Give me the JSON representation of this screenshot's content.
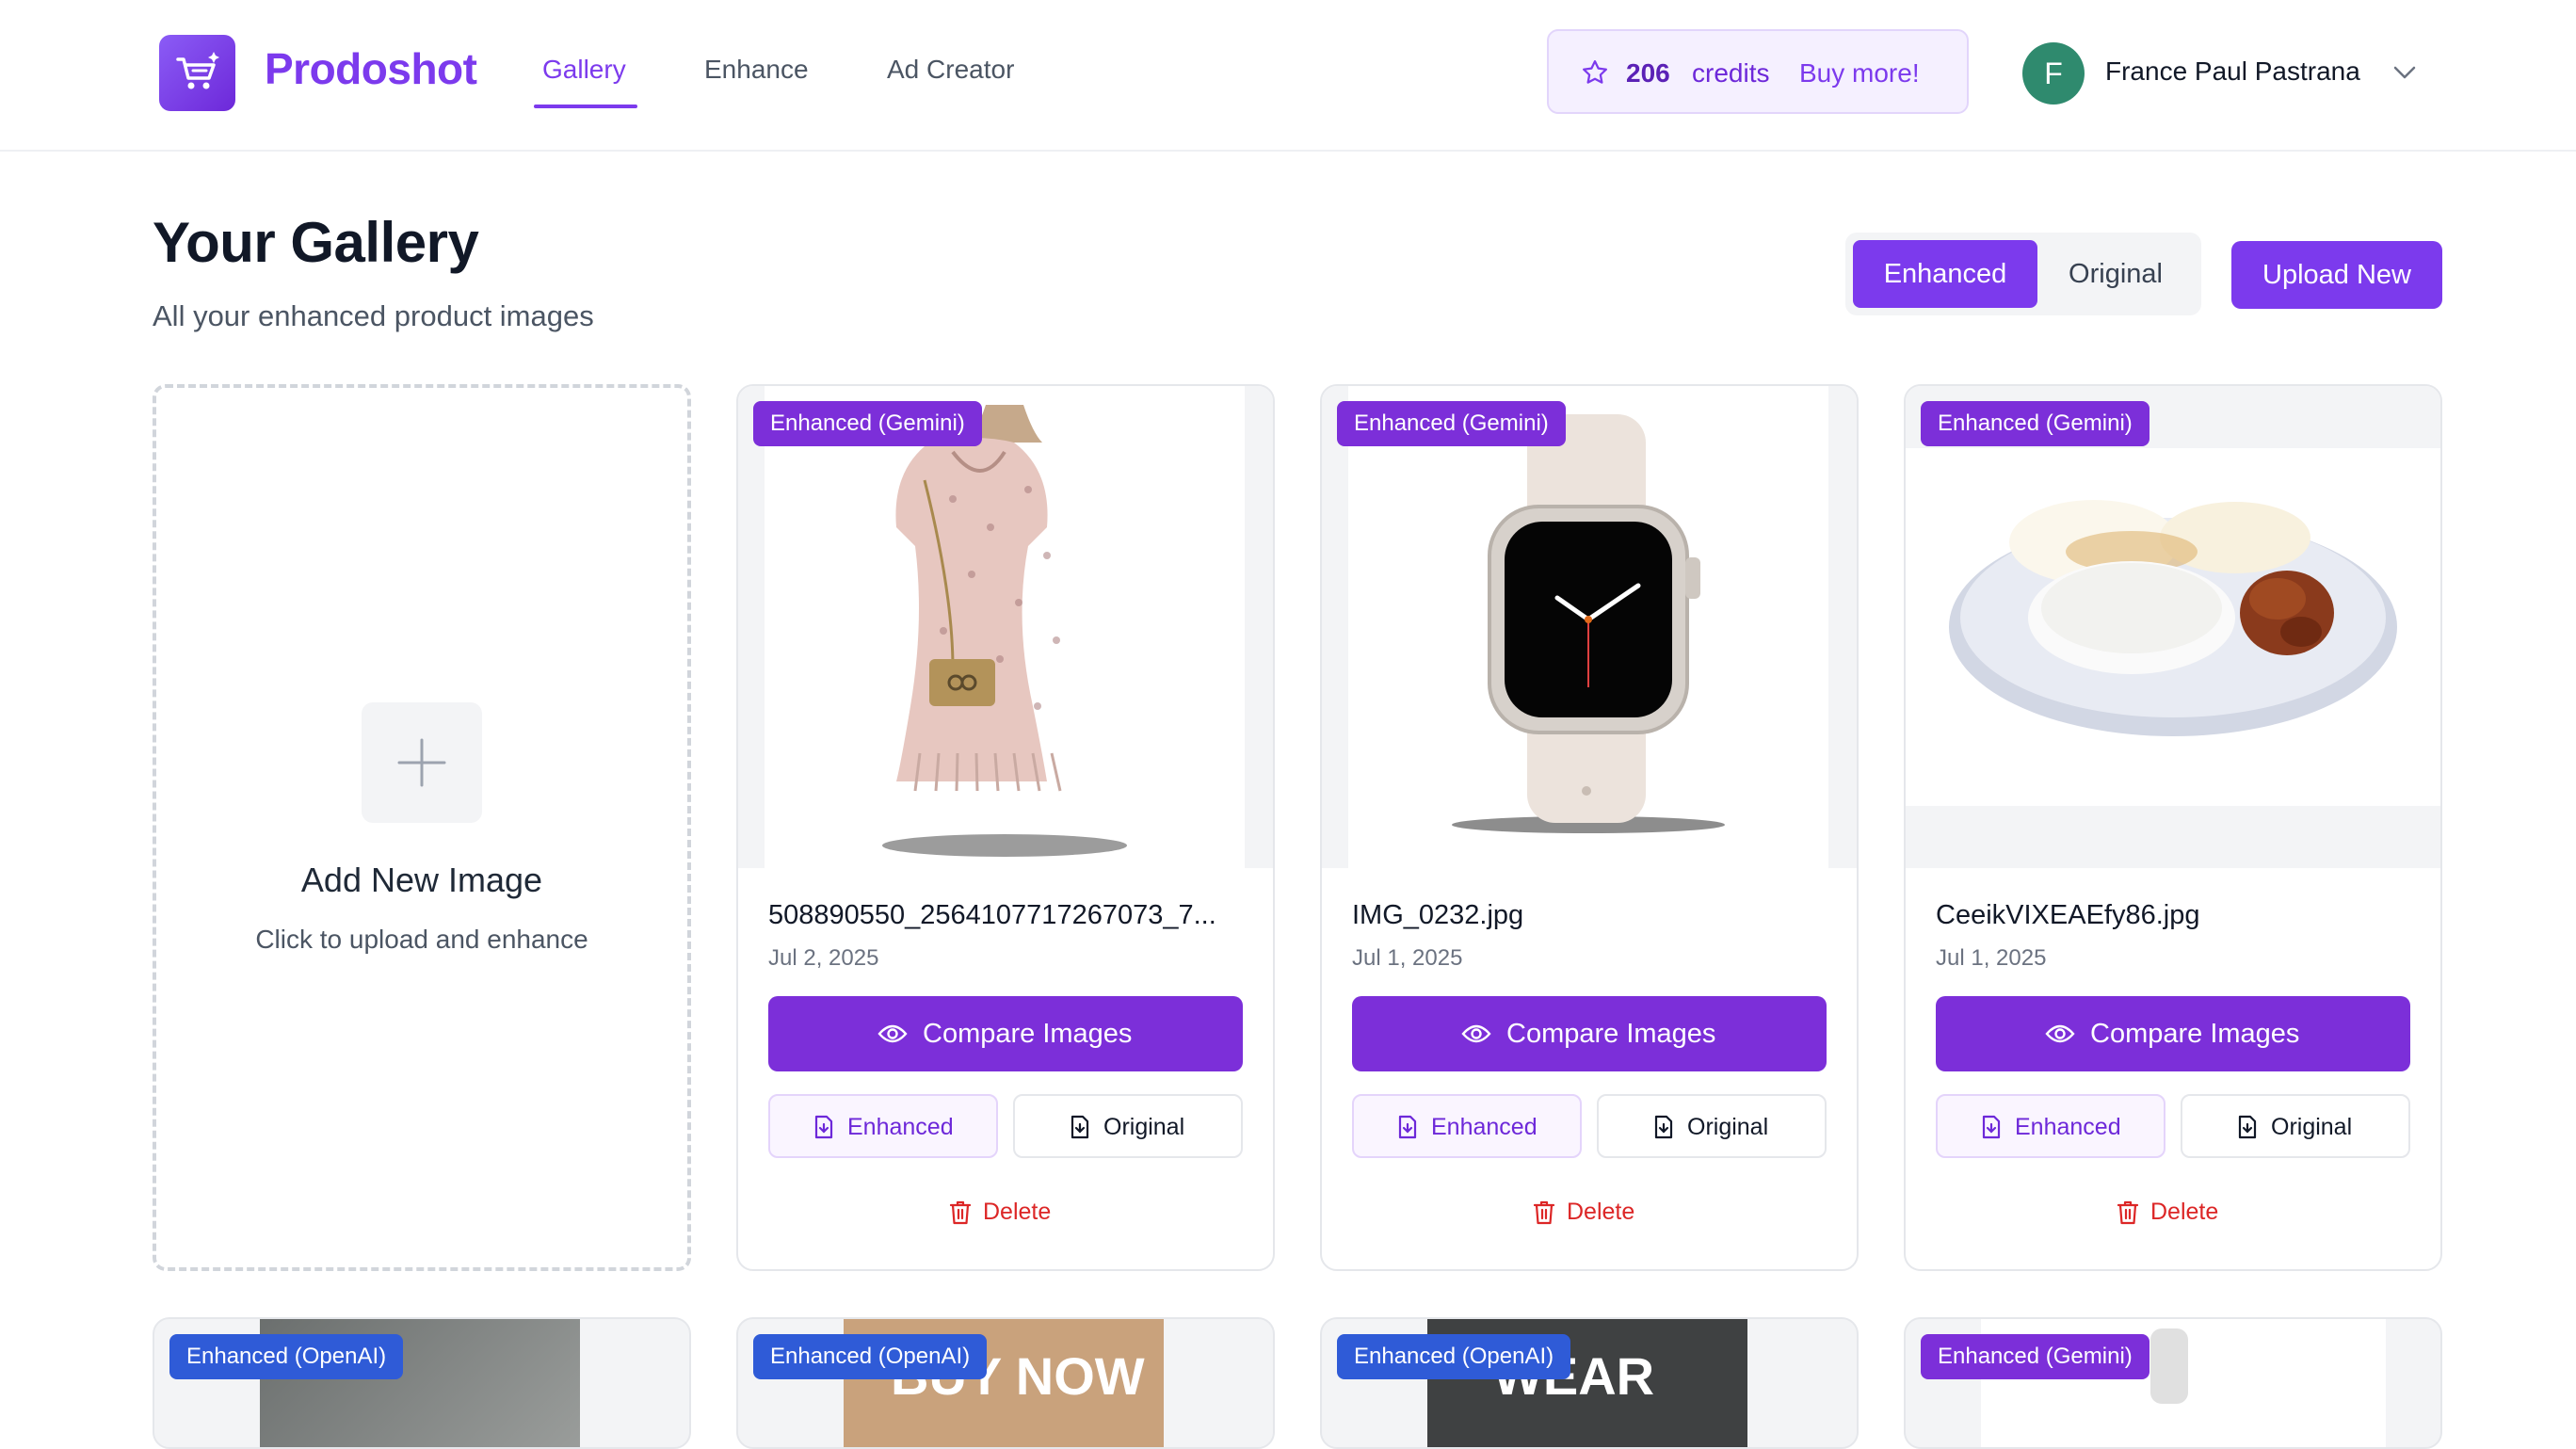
{
  "header": {
    "brand": "Prodoshot",
    "nav": [
      {
        "label": "Gallery",
        "active": true
      },
      {
        "label": "Enhance",
        "active": false
      },
      {
        "label": "Ad Creator",
        "active": false
      }
    ],
    "credits": {
      "count": "206",
      "label": "credits",
      "buy_label": "Buy more!"
    },
    "user": {
      "initial": "F",
      "name": "France Paul Pastrana"
    }
  },
  "page": {
    "title": "Your Gallery",
    "subtitle": "All your enhanced product images",
    "toggle": {
      "enhanced": "Enhanced",
      "original": "Original",
      "selected": "Enhanced"
    },
    "upload_label": "Upload New"
  },
  "add_card": {
    "title": "Add New Image",
    "subtitle": "Click to upload and enhance"
  },
  "cards": [
    {
      "badge": "Enhanced (Gemini)",
      "file_name": "508890550_2564107717267073_7...",
      "date": "Jul 2, 2025",
      "compare_label": "Compare Images",
      "enhanced_label": "Enhanced",
      "original_label": "Original",
      "delete_label": "Delete",
      "image": "dress-with-bag"
    },
    {
      "badge": "Enhanced (Gemini)",
      "file_name": "IMG_0232.jpg",
      "date": "Jul 1, 2025",
      "compare_label": "Compare Images",
      "enhanced_label": "Enhanced",
      "original_label": "Original",
      "delete_label": "Delete",
      "image": "smartwatch"
    },
    {
      "badge": "Enhanced (Gemini)",
      "file_name": "CeeikVIXEAEfy86.jpg",
      "date": "Jul 1, 2025",
      "compare_label": "Compare Images",
      "enhanced_label": "Enhanced",
      "original_label": "Original",
      "delete_label": "Delete",
      "image": "rice-plate"
    }
  ],
  "bottom_cards": [
    {
      "badge": "Enhanced (OpenAI)",
      "image_text": ""
    },
    {
      "badge": "Enhanced (OpenAI)",
      "image_text": "BUY NOW"
    },
    {
      "badge": "Enhanced (OpenAI)",
      "image_text": "WEAR"
    },
    {
      "badge": "Enhanced (Gemini)",
      "image_text": ""
    }
  ],
  "colors": {
    "accent": "#7c3aed",
    "badge_gemini": "#7c2fd9",
    "badge_openai": "#2f5bd7",
    "delete": "#dc2626",
    "avatar": "#2f8a6e"
  },
  "icons": [
    "cart-logo-icon",
    "star-icon",
    "chevron-down-icon",
    "plus-icon",
    "eye-icon",
    "file-download-icon",
    "trash-icon"
  ]
}
